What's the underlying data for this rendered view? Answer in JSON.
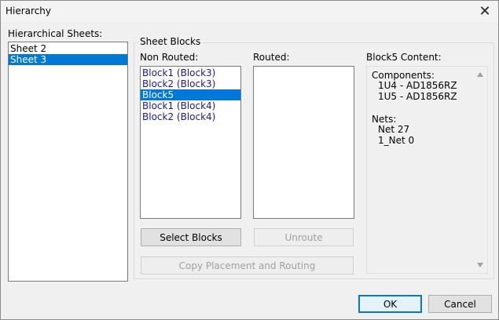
{
  "window": {
    "title": "Hierarchy",
    "close_glyph": "✕"
  },
  "sheets": {
    "label": "Hierarchical Sheets:",
    "items": [
      {
        "label": "Sheet 2",
        "selected": false
      },
      {
        "label": "Sheet 3",
        "selected": true
      }
    ]
  },
  "sheet_blocks": {
    "label": "Sheet Blocks",
    "non_routed": {
      "label": "Non Routed:",
      "items": [
        {
          "label": "Block1 (Block3)",
          "selected": false
        },
        {
          "label": "Block2 (Block3)",
          "selected": false
        },
        {
          "label": "Block5",
          "selected": true
        },
        {
          "label": "Block1 (Block4)",
          "selected": false
        },
        {
          "label": "Block2 (Block4)",
          "selected": false
        }
      ]
    },
    "routed": {
      "label": "Routed:",
      "items": []
    },
    "buttons": {
      "select_blocks": "Select Blocks",
      "unroute": "Unroute",
      "copy_placement": "Copy Placement and Routing"
    },
    "content": {
      "label": "Block5 Content:",
      "components_header": "Components:",
      "components": [
        "1U4 - AD1856RZ",
        "1U5 - AD1856RZ"
      ],
      "nets_header": "Nets:",
      "nets": [
        "Net 27",
        "1_Net 0"
      ]
    }
  },
  "footer": {
    "ok": "OK",
    "cancel": "Cancel"
  },
  "colors": {
    "selection": "#0078d7",
    "block_text": "#1a1a8a"
  },
  "icons": {
    "close": "close-icon",
    "scroll_up": "scroll-up-arrow-icon",
    "scroll_down": "scroll-down-arrow-icon"
  }
}
